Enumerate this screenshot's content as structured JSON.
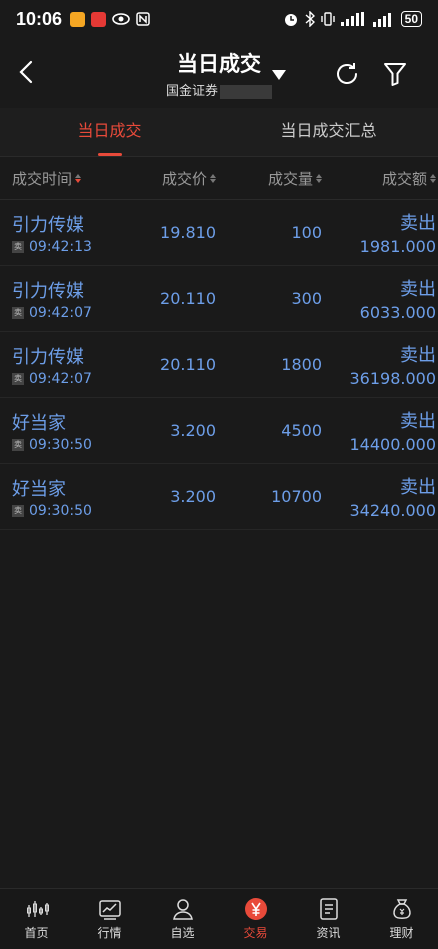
{
  "status": {
    "time": "10:06",
    "battery": "50"
  },
  "header": {
    "title": "当日成交",
    "broker": "国金证券"
  },
  "tabs": [
    {
      "label": "当日成交"
    },
    {
      "label": "当日成交汇总"
    }
  ],
  "columns": {
    "time": "成交时间",
    "price": "成交价",
    "volume": "成交量",
    "amount": "成交额"
  },
  "trades": [
    {
      "name": "引力传媒",
      "tag": "卖",
      "time": "09:42:13",
      "price": "19.810",
      "volume": "100",
      "direction": "卖出",
      "amount": "1981.000"
    },
    {
      "name": "引力传媒",
      "tag": "卖",
      "time": "09:42:07",
      "price": "20.110",
      "volume": "300",
      "direction": "卖出",
      "amount": "6033.000"
    },
    {
      "name": "引力传媒",
      "tag": "卖",
      "time": "09:42:07",
      "price": "20.110",
      "volume": "1800",
      "direction": "卖出",
      "amount": "36198.000"
    },
    {
      "name": "好当家",
      "tag": "卖",
      "time": "09:30:50",
      "price": "3.200",
      "volume": "4500",
      "direction": "卖出",
      "amount": "14400.000"
    },
    {
      "name": "好当家",
      "tag": "卖",
      "time": "09:30:50",
      "price": "3.200",
      "volume": "10700",
      "direction": "卖出",
      "amount": "34240.000"
    }
  ],
  "nav": [
    {
      "label": "首页",
      "icon": "candlestick-icon"
    },
    {
      "label": "行情",
      "icon": "chart-icon"
    },
    {
      "label": "自选",
      "icon": "user-icon"
    },
    {
      "label": "交易",
      "icon": "yen-icon"
    },
    {
      "label": "资讯",
      "icon": "document-icon"
    },
    {
      "label": "理财",
      "icon": "moneybag-icon"
    }
  ],
  "colors": {
    "accent": "#e84a3a",
    "link": "#6d9ee8",
    "background": "#1a1a1a"
  }
}
